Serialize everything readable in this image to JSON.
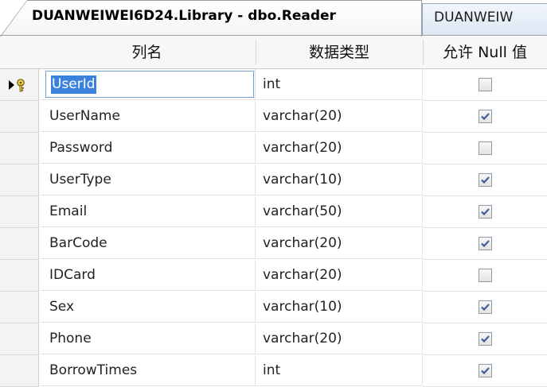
{
  "tabs": [
    {
      "label": "DUANWEIWEI6D24.Library - dbo.Reader",
      "active": true
    },
    {
      "label": "DUANWEIW",
      "active": false
    }
  ],
  "columns": {
    "name": "列名",
    "type": "数据类型",
    "allow_null": "允许 Null 值"
  },
  "rows": [
    {
      "name": "UserId",
      "type": "int",
      "allow_null": false,
      "primary_key": true,
      "current": true
    },
    {
      "name": "UserName",
      "type": "varchar(20)",
      "allow_null": true
    },
    {
      "name": "Password",
      "type": "varchar(20)",
      "allow_null": false
    },
    {
      "name": "UserType",
      "type": "varchar(10)",
      "allow_null": true
    },
    {
      "name": "Email",
      "type": "varchar(50)",
      "allow_null": true
    },
    {
      "name": "BarCode",
      "type": "varchar(20)",
      "allow_null": true
    },
    {
      "name": "IDCard",
      "type": "varchar(20)",
      "allow_null": false
    },
    {
      "name": "Sex",
      "type": "varchar(10)",
      "allow_null": true
    },
    {
      "name": "Phone",
      "type": "varchar(20)",
      "allow_null": true
    },
    {
      "name": "BorrowTimes",
      "type": "int",
      "allow_null": true
    }
  ],
  "icons": {
    "current_row": "current-row-arrow-icon",
    "primary_key": "primary-key-icon",
    "checkbox": "checkbox-icon"
  },
  "colors": {
    "selection": "#3a82dd",
    "check": "#3b5f9e"
  }
}
